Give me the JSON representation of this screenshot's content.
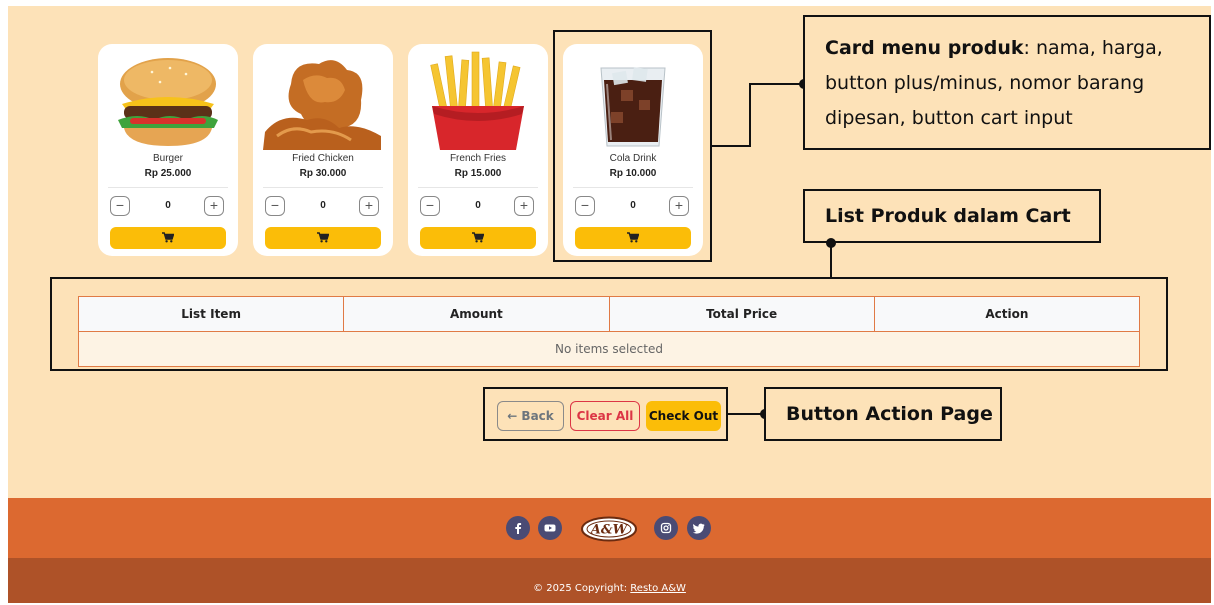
{
  "products": [
    {
      "name": "Burger",
      "price": "Rp 25.000",
      "qty": "0",
      "icon": "burger-image"
    },
    {
      "name": "Fried Chicken",
      "price": "Rp 30.000",
      "qty": "0",
      "icon": "fried-chicken-image"
    },
    {
      "name": "French Fries",
      "price": "Rp 15.000",
      "qty": "0",
      "icon": "french-fries-image"
    },
    {
      "name": "Cola Drink",
      "price": "Rp 10.000",
      "qty": "0",
      "icon": "cola-drink-image"
    }
  ],
  "qty_controls": {
    "minus": "−",
    "plus": "+"
  },
  "annotations": {
    "card_menu_bold": "Card menu produk",
    "card_menu_rest": ": nama, harga, button plus/minus, nomor barang dipesan, button cart input",
    "cart_list": "List Produk dalam Cart",
    "button_action": "Button Action Page"
  },
  "cart_table": {
    "headers": [
      "List Item",
      "Amount",
      "Total Price",
      "Action"
    ],
    "empty_message": "No items selected"
  },
  "actions": {
    "back": "← Back",
    "clear_all": "Clear All",
    "check_out": "Check Out"
  },
  "footer": {
    "logo_text": "A&W",
    "copyright_prefix": "© 2025 Copyright: ",
    "copyright_link": "Resto A&W",
    "social_icons": [
      "facebook-icon",
      "youtube-icon",
      "instagram-icon",
      "twitter-icon"
    ]
  },
  "colors": {
    "page_bg": "#fde2b8",
    "accent_yellow": "#fbbd08",
    "footer_top": "#dc6930",
    "footer_bottom": "#ae5228",
    "social_bg": "#4a4b74",
    "clear_red": "#dc3545"
  }
}
